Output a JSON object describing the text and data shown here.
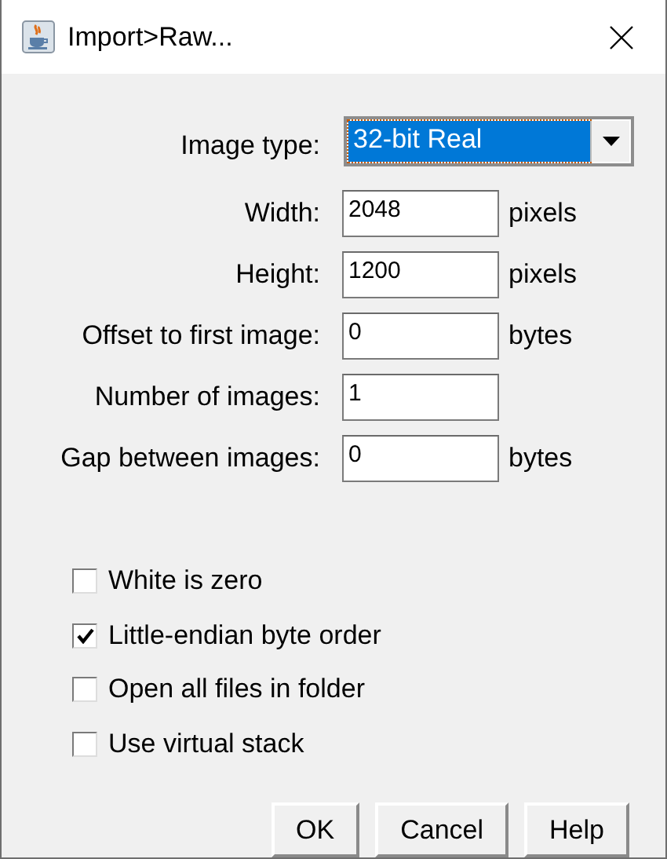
{
  "window": {
    "title": "Import>Raw..."
  },
  "fields": [
    {
      "kind": "choice",
      "label": "Image type:",
      "value": "32-bit Real",
      "focused": true
    },
    {
      "kind": "number",
      "label": "Width:",
      "value": "2048",
      "unit": "pixels"
    },
    {
      "kind": "number",
      "label": "Height:",
      "value": "1200",
      "unit": "pixels"
    },
    {
      "kind": "number",
      "label": "Offset to first image:",
      "value": "0",
      "unit": "bytes"
    },
    {
      "kind": "number",
      "label": "Number of images:",
      "value": "1"
    },
    {
      "kind": "number",
      "label": "Gap between images:",
      "value": "0",
      "unit": "bytes"
    }
  ],
  "options": [
    {
      "label": "White is zero",
      "checked": false
    },
    {
      "label": "Little-endian byte order",
      "checked": true
    },
    {
      "label": "Open all files in folder",
      "checked": false
    },
    {
      "label": "Use virtual stack",
      "checked": false
    }
  ],
  "buttons": [
    "OK",
    "Cancel",
    "Help"
  ]
}
